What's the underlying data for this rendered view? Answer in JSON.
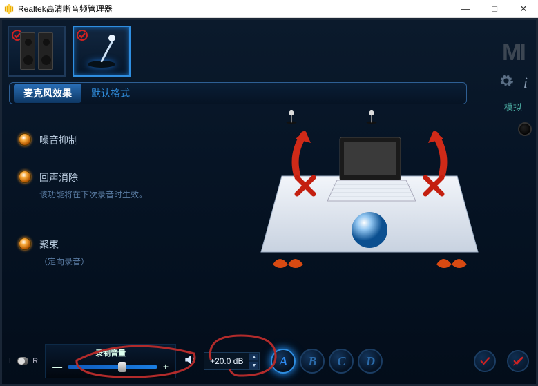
{
  "window": {
    "title": "Realtek高清晰音频管理器",
    "minimize": "—",
    "maximize": "□",
    "close": "✕"
  },
  "logo_text": "MI",
  "sim_link": "模拟",
  "tabs": [
    {
      "id": "mic_effects",
      "label": "麦克风效果",
      "active": true
    },
    {
      "id": "default_format",
      "label": "默认格式",
      "active": false
    }
  ],
  "options": {
    "noise_suppression": {
      "label": "噪音抑制"
    },
    "echo_cancel": {
      "label": "回声消除",
      "sub": "该功能将在下次录音时生效。"
    },
    "beamforming": {
      "label": "聚束",
      "sub": "（定向录音）"
    }
  },
  "bottom": {
    "balance_L": "L",
    "balance_R": "R",
    "volume_title": "录制音量",
    "minus": "—",
    "plus": "+",
    "gain_value": "+20.0 dB",
    "presets": [
      "A",
      "B",
      "C",
      "D"
    ],
    "spin_up": "▲",
    "spin_down": "▼"
  },
  "icons": {
    "check": "check-icon",
    "speakers": "speakers-device-icon",
    "microphone": "microphone-device-icon",
    "gear": "gear-icon",
    "info": "info-icon",
    "jack": "rear-jack-icon",
    "speaker_small": "volume-icon",
    "apply": "apply-icon",
    "cancel": "cancel-icon"
  }
}
